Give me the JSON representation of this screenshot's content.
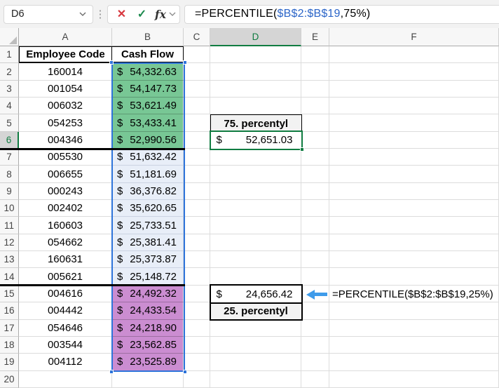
{
  "toolbar": {
    "name_box": "D6",
    "icons": {
      "more": "⋮",
      "cancel": "✕",
      "enter": "✓",
      "fx": "fx"
    },
    "formula": {
      "prefix": "=PERCENTILE(",
      "ref": "$B$2:$B$19",
      "suffix": ",75%)"
    }
  },
  "sheet": {
    "column_headers": [
      "A",
      "B",
      "C",
      "D",
      "E",
      "F"
    ],
    "selected_column": "D",
    "selected_row": "6",
    "header_row": {
      "a": "Employee Code",
      "b": "Cash Flow"
    },
    "currency_symbol": "$",
    "rows": [
      {
        "row": 2,
        "employee_code": "160014",
        "cash_flow": "54,332.63",
        "highlight": "green"
      },
      {
        "row": 3,
        "employee_code": "001054",
        "cash_flow": "54,147.73",
        "highlight": "green"
      },
      {
        "row": 4,
        "employee_code": "006032",
        "cash_flow": "53,621.49",
        "highlight": "green"
      },
      {
        "row": 5,
        "employee_code": "054253",
        "cash_flow": "53,433.41",
        "highlight": "green"
      },
      {
        "row": 6,
        "employee_code": "004346",
        "cash_flow": "52,990.56",
        "highlight": "green"
      },
      {
        "row": 7,
        "employee_code": "005530",
        "cash_flow": "51,632.42",
        "highlight": "blue"
      },
      {
        "row": 8,
        "employee_code": "006655",
        "cash_flow": "51,181.69",
        "highlight": "blue"
      },
      {
        "row": 9,
        "employee_code": "000243",
        "cash_flow": "36,376.82",
        "highlight": "blue"
      },
      {
        "row": 10,
        "employee_code": "002402",
        "cash_flow": "35,620.65",
        "highlight": "blue"
      },
      {
        "row": 11,
        "employee_code": "160603",
        "cash_flow": "25,733.51",
        "highlight": "blue"
      },
      {
        "row": 12,
        "employee_code": "054662",
        "cash_flow": "25,381.41",
        "highlight": "blue"
      },
      {
        "row": 13,
        "employee_code": "160631",
        "cash_flow": "25,373.87",
        "highlight": "blue"
      },
      {
        "row": 14,
        "employee_code": "005621",
        "cash_flow": "25,148.72",
        "highlight": "blue"
      },
      {
        "row": 15,
        "employee_code": "004616",
        "cash_flow": "24,492.32",
        "highlight": "purple"
      },
      {
        "row": 16,
        "employee_code": "004442",
        "cash_flow": "24,433.54",
        "highlight": "purple"
      },
      {
        "row": 17,
        "employee_code": "054646",
        "cash_flow": "24,218.90",
        "highlight": "purple"
      },
      {
        "row": 18,
        "employee_code": "003544",
        "cash_flow": "23,562.85",
        "highlight": "purple"
      },
      {
        "row": 19,
        "employee_code": "004112",
        "cash_flow": "23,525.89",
        "highlight": "purple"
      }
    ],
    "percentile75": {
      "label": "75. percentyl",
      "value": "52,651.03"
    },
    "percentile25": {
      "label": "25. percentyl",
      "value": "24,656.42"
    }
  },
  "annotation": {
    "formula": "=PERCENTILE($B$2:$B$19,25%)"
  },
  "colors": {
    "green_fill": "#78C795",
    "purple_fill": "#CB8DD1",
    "selection_tint": "#E8EEF8",
    "range_border_blue": "#2E74DA",
    "active_green": "#107C41",
    "arrow_blue": "#3E9BEA",
    "formula_ref_blue": "#2B65C8",
    "cancel_red": "#D8383F",
    "enter_green": "#1D8A4E"
  }
}
